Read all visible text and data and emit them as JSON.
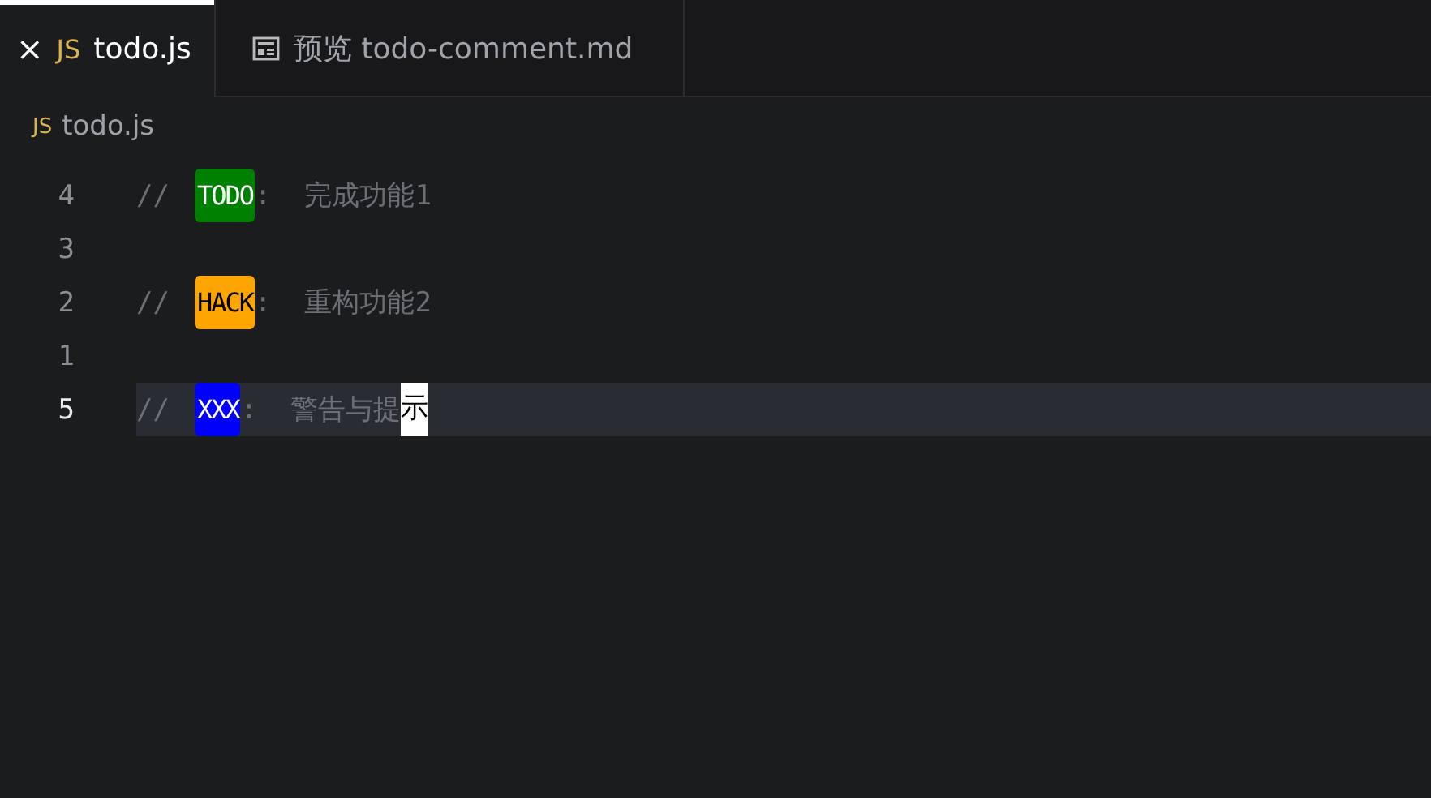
{
  "tabs": [
    {
      "close": "×",
      "lang": "JS",
      "label": "todo.js",
      "kind": "js",
      "selected": true
    },
    {
      "label": "预览 todo-comment.md",
      "kind": "preview",
      "selected": false
    }
  ],
  "breadcrumb": {
    "lang": "JS",
    "label": "todo.js"
  },
  "lines": [
    {
      "number": "4",
      "current": false,
      "prefix": "//",
      "tag": "TODO",
      "color": "#008000",
      "rest": ":  完成功能1"
    },
    {
      "number": "3",
      "current": false
    },
    {
      "number": "2",
      "current": false,
      "prefix": "//",
      "tag": "HACK",
      "color": "#ffa500",
      "rest": ":  重构功能2"
    },
    {
      "number": "1",
      "current": false
    },
    {
      "number": "5",
      "current": true,
      "prefix": "//",
      "tag": "XXX",
      "color": "#0000ff",
      "rest": ":  警告与提",
      "cursor": "示"
    }
  ]
}
